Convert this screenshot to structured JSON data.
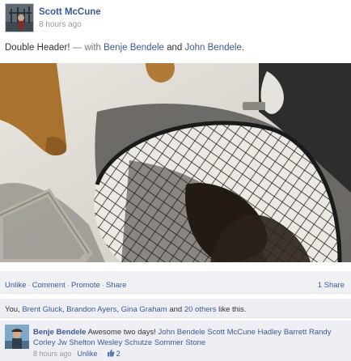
{
  "post": {
    "author": "Scott McCune",
    "timestamp": "8 hours ago",
    "status_text": "Double Header!",
    "with_separator": " — with ",
    "tagged_1": "Benje Bendele",
    "and_text": " and ",
    "tagged_2": "John Bendele",
    "period": "."
  },
  "actions": {
    "unlike": "Unlike",
    "comment": "Comment",
    "promote": "Promote",
    "share": "Share",
    "separator": "·",
    "share_count": "1 Share"
  },
  "likes": {
    "you": "You",
    "comma1": ", ",
    "person1": "Brent Gluck",
    "comma2": ", ",
    "person2": "Brandon Ayers",
    "comma3": ", ",
    "person3": "Gina Graham",
    "and_text": " and ",
    "others": "20 others",
    "suffix": " like this."
  },
  "comment": {
    "author": "Benje Bendele",
    "text": "Awesome two days!",
    "mentions": [
      "John Bendele",
      "Scott McCune",
      "Hadley Barrett",
      "Randy Corley",
      "Jw Shelton",
      "Wesley Schutze",
      "Sommer Stone"
    ],
    "timestamp": "8 hours ago",
    "separator": "·",
    "unlike": "Unlike",
    "like_count": "2"
  },
  "icons": {
    "photo": "fishing-net-dog-photo",
    "like": "thumbs-up-icon"
  },
  "colors": {
    "link": "#3b5998",
    "muted": "#999999",
    "panel": "#edeff4"
  }
}
